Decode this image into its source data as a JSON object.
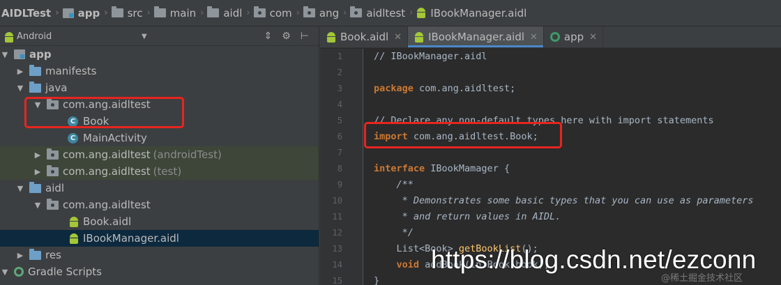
{
  "breadcrumb": [
    {
      "label": "AIDLTest",
      "icon": "none",
      "bold": true
    },
    {
      "label": "app",
      "icon": "app-module-icon",
      "bold": true
    },
    {
      "label": "src",
      "icon": "folder-icon"
    },
    {
      "label": "main",
      "icon": "folder-icon"
    },
    {
      "label": "aidl",
      "icon": "folder-icon"
    },
    {
      "label": "com",
      "icon": "package-icon"
    },
    {
      "label": "ang",
      "icon": "package-icon"
    },
    {
      "label": "aidltest",
      "icon": "package-icon"
    },
    {
      "label": "IBookManager.aidl",
      "icon": "android-icon"
    }
  ],
  "project_panel": {
    "view_mode": "Android",
    "tree": [
      {
        "label": "app",
        "icon": "app-module-icon",
        "expanded": true,
        "bold": true
      },
      {
        "label": "manifests",
        "icon": "folder-icon",
        "expanded": false
      },
      {
        "label": "java",
        "icon": "folder-icon",
        "expanded": true
      },
      {
        "label": "com.ang.aidltest",
        "icon": "package-icon",
        "expanded": true
      },
      {
        "label": "Book",
        "icon": "class-icon"
      },
      {
        "label": "MainActivity",
        "icon": "class-icon"
      },
      {
        "label": "com.ang.aidltest",
        "suffix": "(androidTest)",
        "icon": "package-icon",
        "expanded": false
      },
      {
        "label": "com.ang.aidltest",
        "suffix": "(test)",
        "icon": "package-icon",
        "expanded": false
      },
      {
        "label": "aidl",
        "icon": "folder-icon",
        "expanded": true
      },
      {
        "label": "com.ang.aidltest",
        "icon": "package-icon",
        "expanded": true
      },
      {
        "label": "Book.aidl",
        "icon": "android-icon"
      },
      {
        "label": "IBookManager.aidl",
        "icon": "android-icon",
        "selected": true
      },
      {
        "label": "res",
        "icon": "folder-icon",
        "expanded": false
      },
      {
        "label": "Gradle Scripts",
        "icon": "gradle-icon",
        "expanded": true
      }
    ]
  },
  "tabs": [
    {
      "label": "Book.aidl",
      "icon": "android-icon",
      "active": false
    },
    {
      "label": "IBookManager.aidl",
      "icon": "android-icon",
      "active": true
    },
    {
      "label": "app",
      "icon": "app-circle-icon",
      "active": false
    }
  ],
  "code": {
    "line_numbers": [
      "1",
      "2",
      "3",
      "4",
      "5",
      "6",
      "7",
      "8",
      "9",
      "10",
      "11",
      "12",
      "13",
      "14",
      "15"
    ],
    "l1": "// IBookManager.aidl",
    "l3_kw": "package",
    "l3_rest": " com.ang.aidltest;",
    "l5": "// Declare any non-default types here with import statements",
    "l6_kw": "import",
    "l6_rest": " com.ang.aidltest.Book;",
    "l8_kw": "interface",
    "l8_rest": " IBookMamager {",
    "l9": "    /**",
    "l10": "     * Demonstrates some basic types that you can use as parameters",
    "l11": "     * and return values in AIDL.",
    "l12": "     */",
    "l13_a": "    List<Book> ",
    "l13_fn": "getBookList",
    "l13_b": "();",
    "l14_kw": "    void",
    "l14_rest": " addBook(in Book book);",
    "l15": "}"
  },
  "colors": {
    "accent": "#4a88c7",
    "highlight_box": "#e8251f",
    "keyword": "#cc7832",
    "comment": "#808080",
    "doc_comment": "#629755"
  },
  "watermark": {
    "main": "https://blog.csdn.net/ezconn",
    "sub": "@稀土掘金技术社区"
  }
}
